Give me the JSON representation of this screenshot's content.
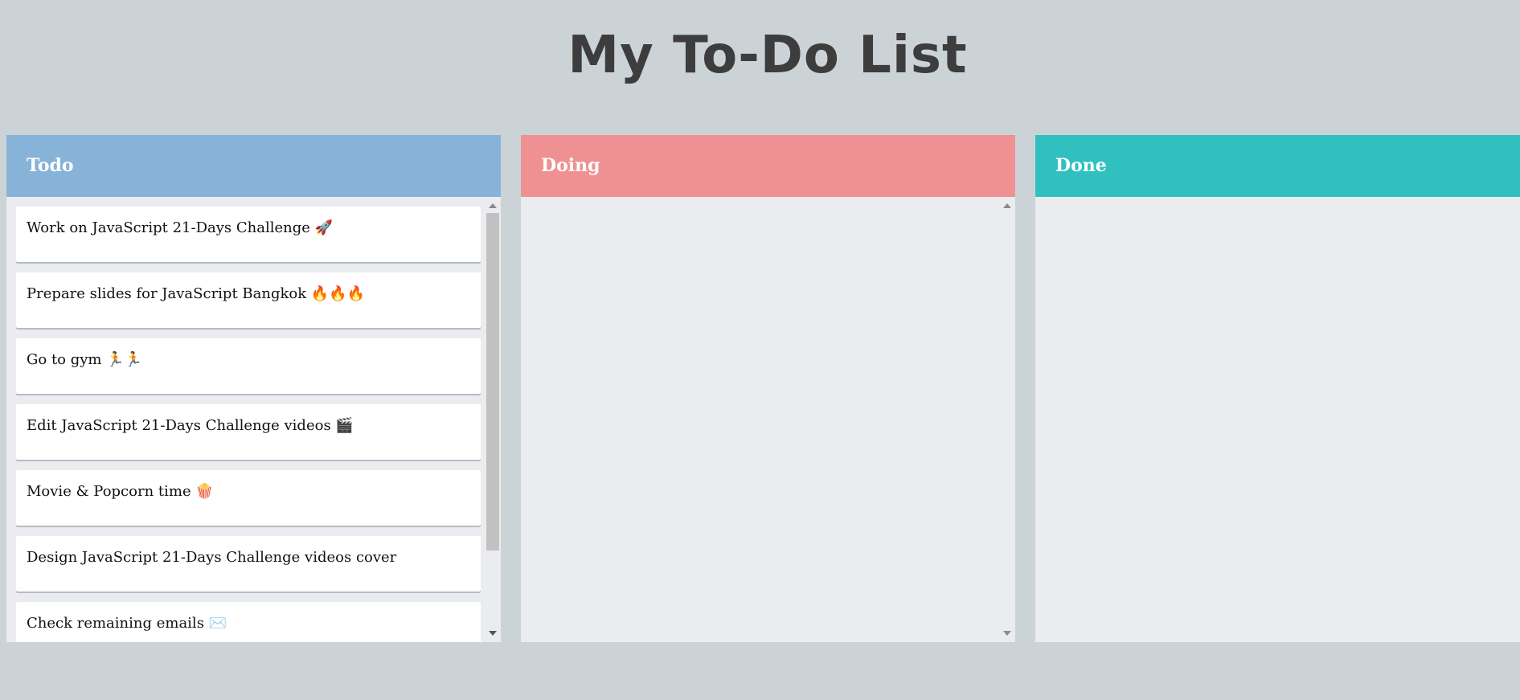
{
  "page": {
    "title": "My To-Do List"
  },
  "columns": [
    {
      "title": "Todo",
      "color": "#87b3d9",
      "cards": [
        "Work on JavaScript 21-Days Challenge 🚀",
        "Prepare slides for JavaScript Bangkok 🔥🔥🔥",
        "Go to gym 🏃🏃",
        "Edit JavaScript 21-Days Challenge videos 🎬",
        "Movie & Popcorn time 🍿",
        "Design JavaScript 21-Days Challenge videos cover",
        "Check remaining emails ✉️"
      ]
    },
    {
      "title": "Doing",
      "color": "#ef9193",
      "cards": []
    },
    {
      "title": "Done",
      "color": "#30c0c0",
      "cards": []
    }
  ]
}
